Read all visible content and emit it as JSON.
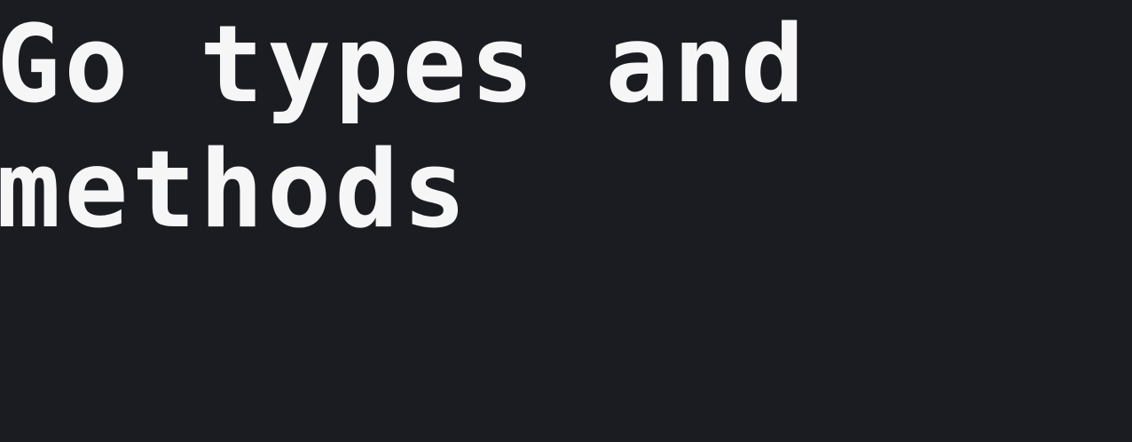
{
  "page": {
    "title_lines": [
      "Go types and",
      "methods"
    ],
    "colors": {
      "background": "#1b1c21",
      "text": "#f6f6f7"
    }
  }
}
